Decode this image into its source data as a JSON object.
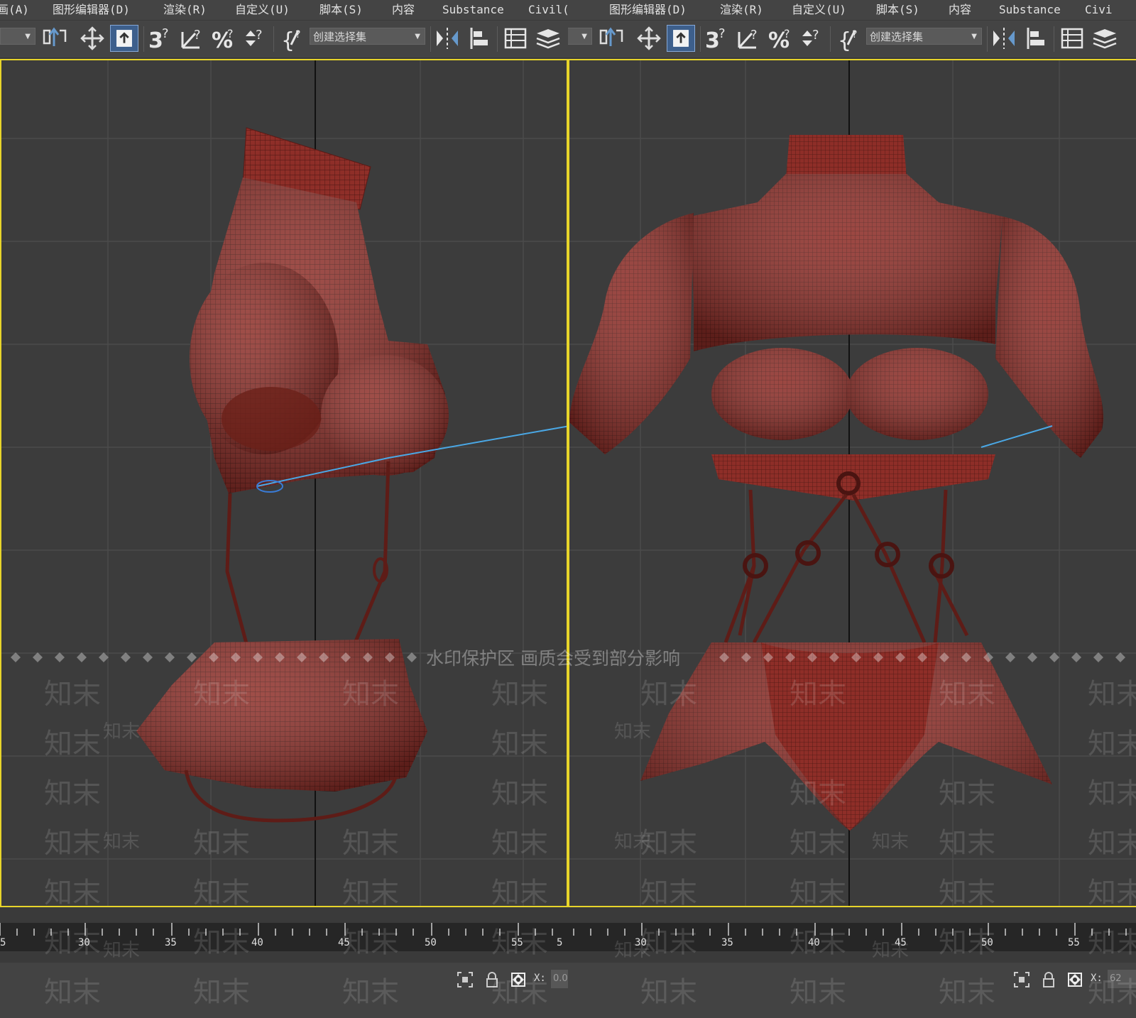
{
  "menu": [
    "画(A)",
    "图形编辑器(D)",
    "渲染(R)",
    "自定义(U)",
    "脚本(S)",
    "内容",
    "Substance",
    "Civil(A)"
  ],
  "menu_right": [
    "图形编辑器(D)",
    "渲染(R)",
    "自定义(U)",
    "脚本(S)",
    "内容",
    "Substance",
    "Civi"
  ],
  "toolbar": {
    "selection_set_placeholder": "创建选择集",
    "icons": [
      "select-move-icon",
      "move-icon",
      "select-object-icon",
      "snap-3d-icon",
      "angle-snap-icon",
      "percent-snap-icon",
      "spinner-snap-icon",
      "named-selection-icon",
      "mirror-icon",
      "align-icon",
      "scene-explorer-icon",
      "layer-icon"
    ]
  },
  "timeline": {
    "ticks_left": [
      "5",
      "30",
      "35",
      "40",
      "45",
      "50",
      "55",
      "5"
    ],
    "ticks_right": [
      "30",
      "35",
      "40",
      "45",
      "50",
      "55"
    ]
  },
  "status": {
    "x_label": "X:",
    "x_value_left": "0.0",
    "x_value_right": "62"
  },
  "watermark": {
    "banner": "水印保护区  画质会受到部分影响",
    "brand": "知末"
  },
  "colors": {
    "viewport_border": "#e8d52a",
    "mesh": "#8e2e28",
    "background": "#3c3c3c"
  }
}
